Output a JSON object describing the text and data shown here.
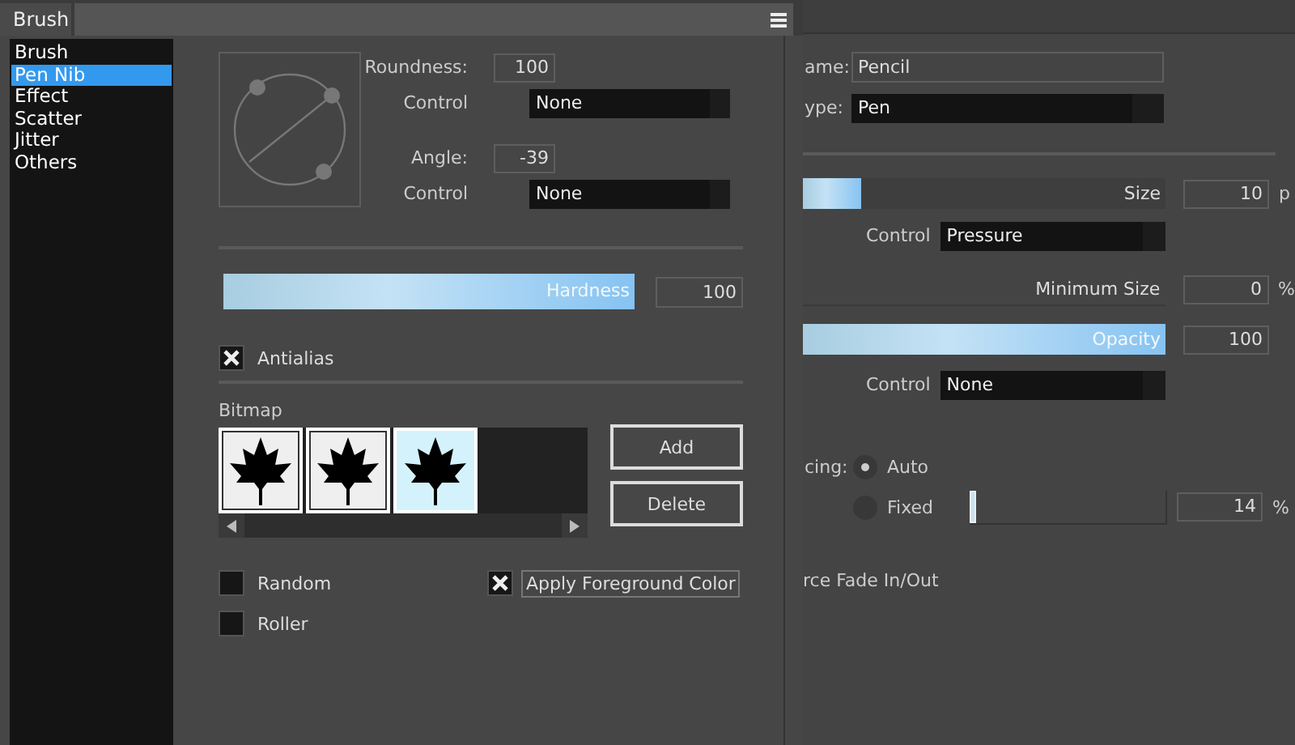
{
  "front_panel": {
    "tab": "Brush",
    "sidebar": {
      "items": [
        {
          "label": "Brush",
          "selected": false
        },
        {
          "label": "Pen Nib",
          "selected": true
        },
        {
          "label": "Effect",
          "selected": false
        },
        {
          "label": "Scatter",
          "selected": false
        },
        {
          "label": "Jitter",
          "selected": false
        },
        {
          "label": "Others",
          "selected": false
        }
      ]
    },
    "roundness": {
      "label": "Roundness:",
      "value": "100"
    },
    "roundness_control": {
      "label": "Control",
      "value": "None"
    },
    "angle": {
      "label": "Angle:",
      "value": "-39"
    },
    "angle_control": {
      "label": "Control",
      "value": "None"
    },
    "hardness": {
      "label": "Hardness",
      "level": 1,
      "value": "100"
    },
    "antialias": {
      "label": "Antialias",
      "checked": true
    },
    "bitmap": {
      "label": "Bitmap",
      "thumbnails": [
        {
          "selected": false
        },
        {
          "selected": false
        },
        {
          "selected": true
        }
      ]
    },
    "buttons": [
      "Add",
      "Delete"
    ],
    "options": [
      {
        "label": "Random",
        "checked": false
      },
      {
        "label": "Apply Foreground Color",
        "checked": true
      },
      {
        "label": "Roller",
        "checked": false
      }
    ]
  },
  "back_panel": {
    "name": {
      "label": "ame:",
      "value": "Pencil"
    },
    "type": {
      "label": "ype:",
      "value": "Pen"
    },
    "size": {
      "label": "Size",
      "level": 0.16,
      "value": "10",
      "unit": "p"
    },
    "size_control": {
      "label": "Control",
      "value": "Pressure"
    },
    "minimum_size": {
      "label": "Minimum Size",
      "value": "0",
      "unit": "%"
    },
    "opacity": {
      "label": "Opacity",
      "level": 1,
      "value": "100"
    },
    "opacity_control": {
      "label": "Control",
      "value": "None"
    },
    "spacing": {
      "label": "cing:",
      "options": [
        {
          "label": "Auto",
          "selected": true
        },
        {
          "label": "Fixed",
          "selected": false
        }
      ],
      "level": 0.03,
      "value": "14",
      "unit": "%"
    },
    "fade": "rce Fade In/Out"
  }
}
